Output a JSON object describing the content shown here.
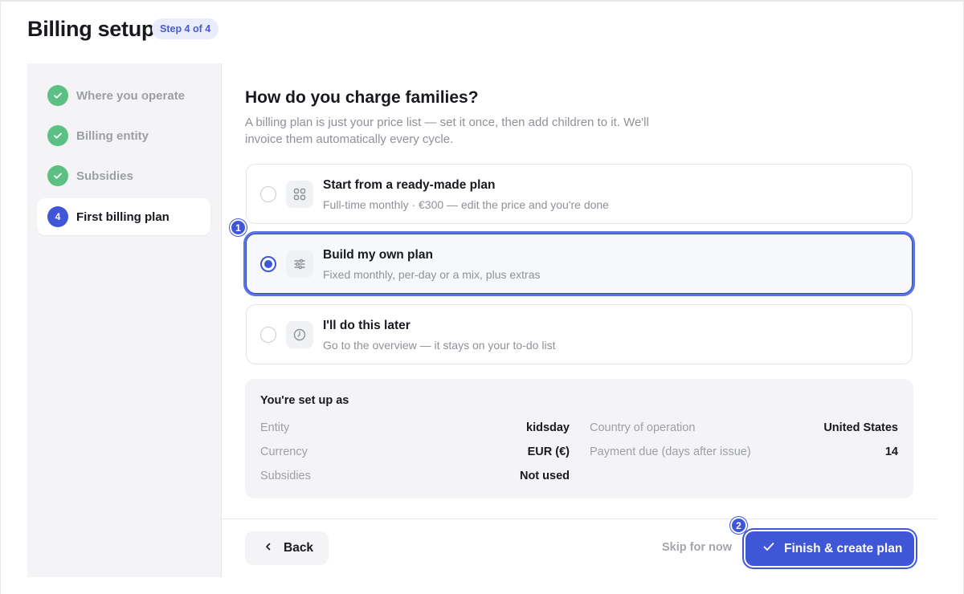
{
  "header": {
    "title": "Billing setup",
    "step_badge": "Step 4 of 4"
  },
  "sidebar": {
    "items": [
      {
        "label": "Where you operate",
        "status": "done"
      },
      {
        "label": "Billing entity",
        "status": "done"
      },
      {
        "label": "Subsidies",
        "status": "done"
      },
      {
        "label": "First billing plan",
        "status": "current",
        "number": "4"
      }
    ]
  },
  "main": {
    "heading": "How do you charge families?",
    "subtext": "A billing plan is just your price list — set it once, then add children to it. We'll invoice them automatically every cycle.",
    "options": [
      {
        "title": "Start from a ready-made plan",
        "description": "Full-time monthly · €300 — edit the price and you're done",
        "icon": "grid-icon",
        "selected": false
      },
      {
        "title": "Build my own plan",
        "description": "Fixed monthly, per-day or a mix, plus extras",
        "icon": "sliders-icon",
        "selected": true
      },
      {
        "title": "I'll do this later",
        "description": "Go to the overview — it stays on your to-do list",
        "icon": "clock-icon",
        "selected": false
      }
    ]
  },
  "summary": {
    "title": "You're set up as",
    "rows_left": [
      {
        "label": "Entity",
        "value": "kidsday"
      },
      {
        "label": "Currency",
        "value": "EUR (€)"
      },
      {
        "label": "Subsidies",
        "value": "Not used"
      }
    ],
    "rows_right": [
      {
        "label": "Country of operation",
        "value": "United States"
      },
      {
        "label": "Payment due (days after issue)",
        "value": "14"
      }
    ]
  },
  "footer": {
    "back_label": "Back",
    "skip_label": "Skip for now",
    "primary_label": "Finish & create plan"
  },
  "annotations": {
    "badge_1": "1",
    "badge_2": "2"
  },
  "colors": {
    "accent": "#3f57d6",
    "success": "#5cbf83",
    "muted_text": "#8e9198",
    "panel_bg": "#f4f4f6"
  }
}
